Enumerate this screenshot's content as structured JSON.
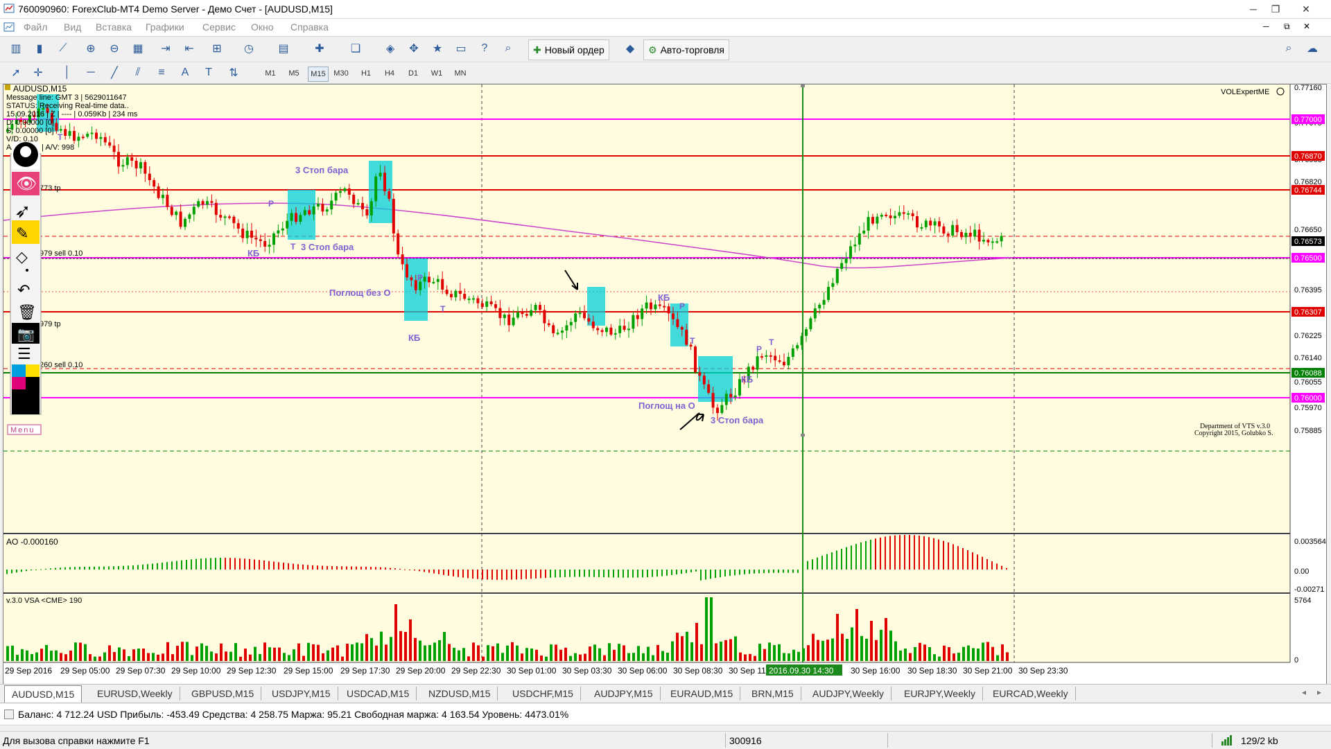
{
  "window": {
    "title": "760090960: ForexClub-MT4 Demo Server - Демо Счет - [AUDUSD,M15]"
  },
  "menu": [
    "Файл",
    "Вид",
    "Вставка",
    "Графики",
    "Сервис",
    "Окно",
    "Справка"
  ],
  "toolbar": {
    "new_order": "Новый ордер",
    "auto_trading": "Авто-торговля",
    "timeframes": [
      "M1",
      "M5",
      "M15",
      "M30",
      "H1",
      "H4",
      "D1",
      "W1",
      "MN"
    ],
    "active_timeframe": "M15"
  },
  "chart": {
    "symbol_label": "AUDUSD,M15",
    "info_lines": [
      "Message line: GMT 3 | 5629011647",
      "STATUS: Receiving Real-time data..",
      "15.09.2016 | Z | ---- | 0.059Kb | 234 ms",
      "D: 0.00000 [0]",
      "S: 0.00000 [0]",
      "V/D: 0.10",
      "A/D: 3711 | A/V: 998"
    ],
    "vol_expert": "VOLExpertME",
    "dept_line1": "Department of VTS  v.3.0",
    "dept_line2": "Copyright 2015, Golubko S.",
    "menu_label": "Menu",
    "price_axis": [
      "0.77160",
      "0.77075",
      "0.76905",
      "0.76820",
      "0.76650",
      "0.76395",
      "0.76225",
      "0.76140",
      "0.76055",
      "0.75970",
      "0.75885"
    ],
    "price_badges": [
      {
        "label": "0.77000",
        "color": "#ff00ff"
      },
      {
        "label": "0.76870",
        "color": "#e00000"
      },
      {
        "label": "0.76744",
        "color": "#e00000"
      },
      {
        "label": "0.76573",
        "color": "#000000"
      },
      {
        "label": "0.76500",
        "color": "#ff00ff"
      },
      {
        "label": "0.76307",
        "color": "#e00000"
      },
      {
        "label": "0.76088",
        "color": "#008000"
      },
      {
        "label": "0.76000",
        "color": "#ff00ff"
      }
    ],
    "level_labels": {
      "tp1": "773 tp",
      "sell1": "979 sell 0.10",
      "tp2": "979 tp",
      "sell2": "260 sell 0.10"
    },
    "annotations": {
      "stop3_a": "3 Стоп бара",
      "stop3_b": "3 Стоп бара",
      "stop3_c": "3 Стоп бара",
      "engulf_no_o": "Поглощ без О",
      "engulf_on_o": "Поглощ на О",
      "kb_1": "КБ",
      "kb_2": "КБ",
      "kb_3": "КБ",
      "kb_4": "КБ",
      "t": "Т",
      "r": "Р"
    },
    "ao_label": "AO -0.000160",
    "ao_axis": [
      "0.003564",
      "0.00",
      "-0.00271"
    ],
    "vsa_label": "v.3.0 VSA <CME> 190",
    "vsa_axis": [
      "5764",
      "0"
    ],
    "time_axis": [
      "29 Sep 2016",
      "29 Sep 05:00",
      "29 Sep 07:30",
      "29 Sep 10:00",
      "29 Sep 12:30",
      "29 Sep 15:00",
      "29 Sep 17:30",
      "29 Sep 20:00",
      "29 Sep 22:30",
      "30 Sep 01:00",
      "30 Sep 03:30",
      "30 Sep 06:00",
      "30 Sep 08:30",
      "30 Sep 11",
      "30 Sep 16:00",
      "30 Sep 18:30",
      "30 Sep 21:00",
      "30 Sep 23:30"
    ],
    "cursor_time": "2016.09.30 14:30"
  },
  "tabs": [
    "AUDUSD,M15",
    "EURUSD,Weekly",
    "GBPUSD,M15",
    "USDJPY,M15",
    "USDCAD,M15",
    "NZDUSD,M15",
    "USDCHF,M15",
    "AUDJPY,M15",
    "EURAUD,M15",
    "BRN,M15",
    "AUDJPY,Weekly",
    "EURJPY,Weekly",
    "EURCAD,Weekly"
  ],
  "account": {
    "text": "Баланс: 4 712.24 USD  Прибыль: -453.49  Средства: 4 258.75  Маржа: 95.21  Свободная маржа: 4 163.54  Уровень: 4473.01%"
  },
  "status": {
    "help": "Для вызова справки нажмите F1",
    "code": "300916",
    "traffic": "129/2 kb"
  },
  "colors": {
    "chart_bg": "#fffce0",
    "bull": "#00a000",
    "bear": "#e00000",
    "magenta": "#ff00ff",
    "cyan_box": "#00d0d8",
    "annot": "#8060d0"
  }
}
